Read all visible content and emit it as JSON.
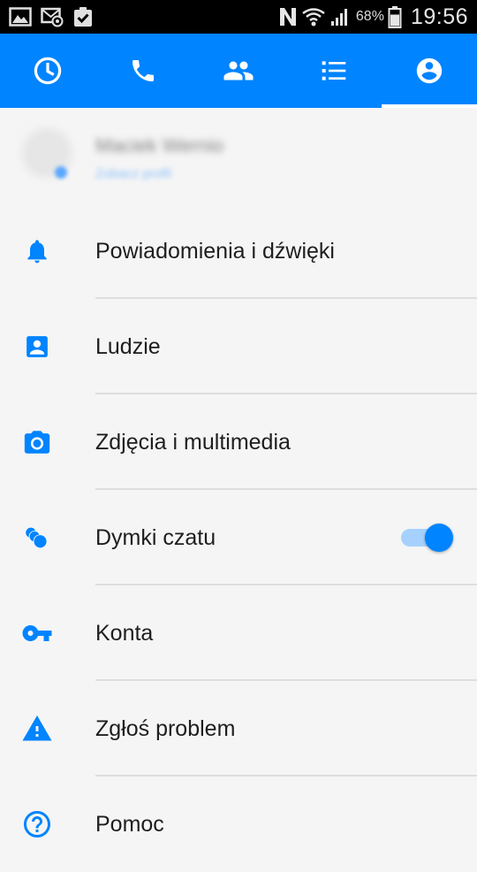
{
  "status_bar": {
    "battery_percent": "68%",
    "time": "19:56"
  },
  "tabs": [
    {
      "id": "recent",
      "icon": "clock-icon"
    },
    {
      "id": "calls",
      "icon": "phone-icon"
    },
    {
      "id": "groups",
      "icon": "people-icon"
    },
    {
      "id": "list",
      "icon": "list-icon"
    },
    {
      "id": "profile",
      "icon": "account-circle-icon",
      "active": true
    }
  ],
  "profile": {
    "name": "Maciek Wernio",
    "subtitle": "Zobacz profil"
  },
  "menu": {
    "items": [
      {
        "label": "Powiadomienia i dźwięki",
        "icon": "bell-icon"
      },
      {
        "label": "Ludzie",
        "icon": "contact-card-icon"
      },
      {
        "label": "Zdjęcia i multimedia",
        "icon": "camera-icon"
      },
      {
        "label": "Dymki czatu",
        "icon": "chat-heads-icon",
        "toggle_on": true
      },
      {
        "label": "Konta",
        "icon": "key-icon"
      },
      {
        "label": "Zgłoś problem",
        "icon": "warning-icon"
      },
      {
        "label": "Pomoc",
        "icon": "help-icon"
      }
    ]
  },
  "colors": {
    "accent": "#0084ff",
    "toggle_track": "#a6d1ff"
  }
}
